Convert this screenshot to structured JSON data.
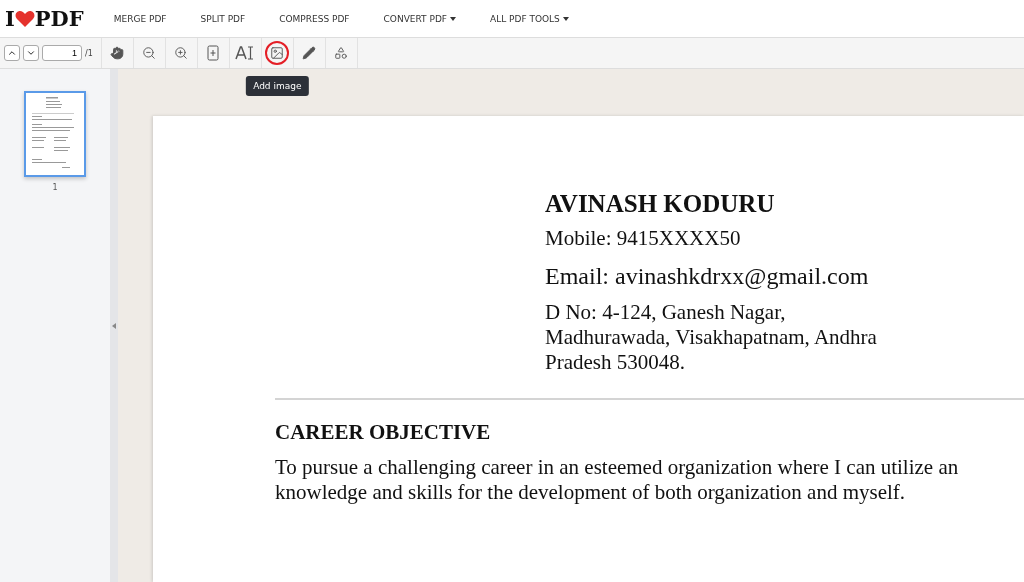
{
  "logo": {
    "left": "I",
    "right": "PDF"
  },
  "nav": [
    {
      "label": "MERGE PDF",
      "dropdown": false
    },
    {
      "label": "SPLIT PDF",
      "dropdown": false
    },
    {
      "label": "COMPRESS PDF",
      "dropdown": false
    },
    {
      "label": "CONVERT PDF",
      "dropdown": true
    },
    {
      "label": "ALL PDF TOOLS",
      "dropdown": true
    }
  ],
  "pager": {
    "value": "1",
    "total": "/1"
  },
  "tools": [
    {
      "kind": "hand",
      "highlighted": false
    },
    {
      "kind": "zoom-out",
      "highlighted": false
    },
    {
      "kind": "zoom-in",
      "highlighted": false
    },
    {
      "kind": "fit",
      "highlighted": false
    },
    {
      "kind": "text",
      "highlighted": false
    },
    {
      "kind": "image",
      "highlighted": true,
      "tooltip": "Add image"
    },
    {
      "kind": "pencil",
      "highlighted": false
    },
    {
      "kind": "shapes",
      "highlighted": false
    }
  ],
  "thumbnails": [
    {
      "label": "1",
      "selected": true
    }
  ],
  "document": {
    "name": "AVINASH KODURU",
    "mobile": "Mobile: 9415XXXX50",
    "email": "Email: avinashkdrxx@gmail.com",
    "address": [
      "D No: 4-124, Ganesh Nagar,",
      "Madhurawada, Visakhapatnam, Andhra",
      "Pradesh 530048."
    ],
    "heading": "CAREER OBJECTIVE",
    "body": [
      "To pursue a challenging career in an esteemed organization where I can utilize an",
      "knowledge and skills for the development of both organization and myself."
    ]
  }
}
